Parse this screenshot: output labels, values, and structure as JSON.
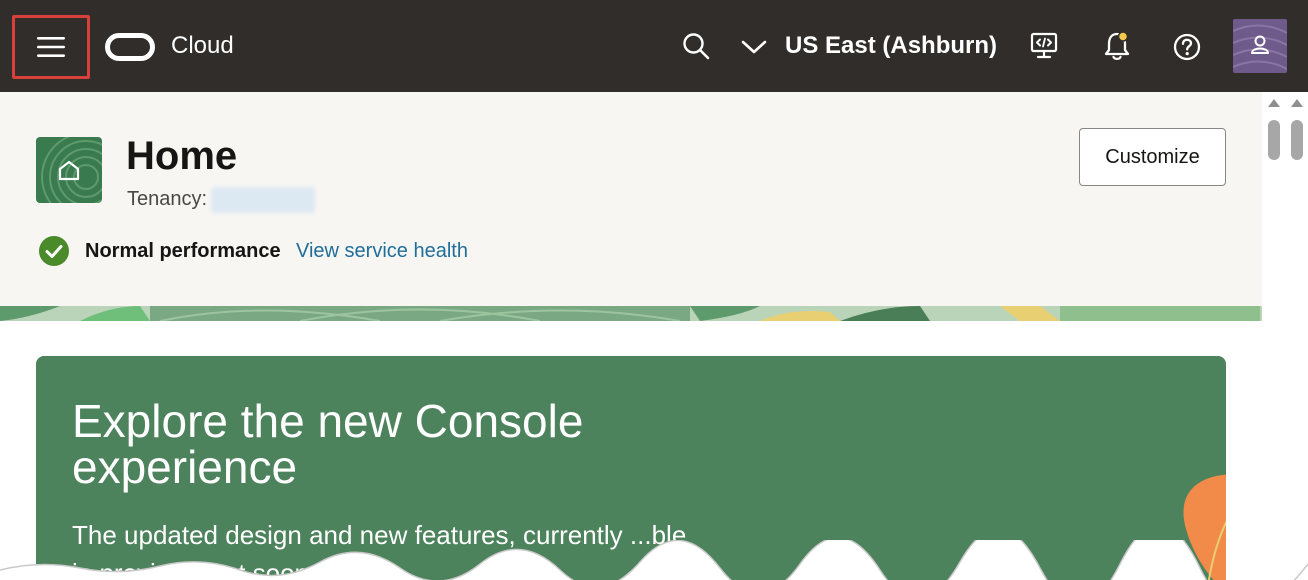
{
  "topbar": {
    "brand": "Cloud",
    "region": "US East (Ashburn)",
    "icons": {
      "menu": "hamburger-menu-icon",
      "search": "search-icon",
      "region_toggle": "chevron-down-icon",
      "developer": "developer-tools-icon",
      "notifications": "bell-icon",
      "help": "help-icon",
      "profile": "user-avatar-icon"
    }
  },
  "header": {
    "title": "Home",
    "tenancy_label": "Tenancy:",
    "customize_label": "Customize",
    "health_status": "Normal performance",
    "health_link": "View service health"
  },
  "promo": {
    "title": "Explore the new Console experience",
    "body": "The updated design and new features, currently ...ble in preview, ...nt soon. If y..."
  },
  "colors": {
    "topbar_bg": "#312d2a",
    "header_bg": "#f8f6f3",
    "promo_bg": "#4c825c",
    "link": "#1f6e9a",
    "highlight_border": "#d9403b",
    "status_green": "#4a8a2a"
  }
}
